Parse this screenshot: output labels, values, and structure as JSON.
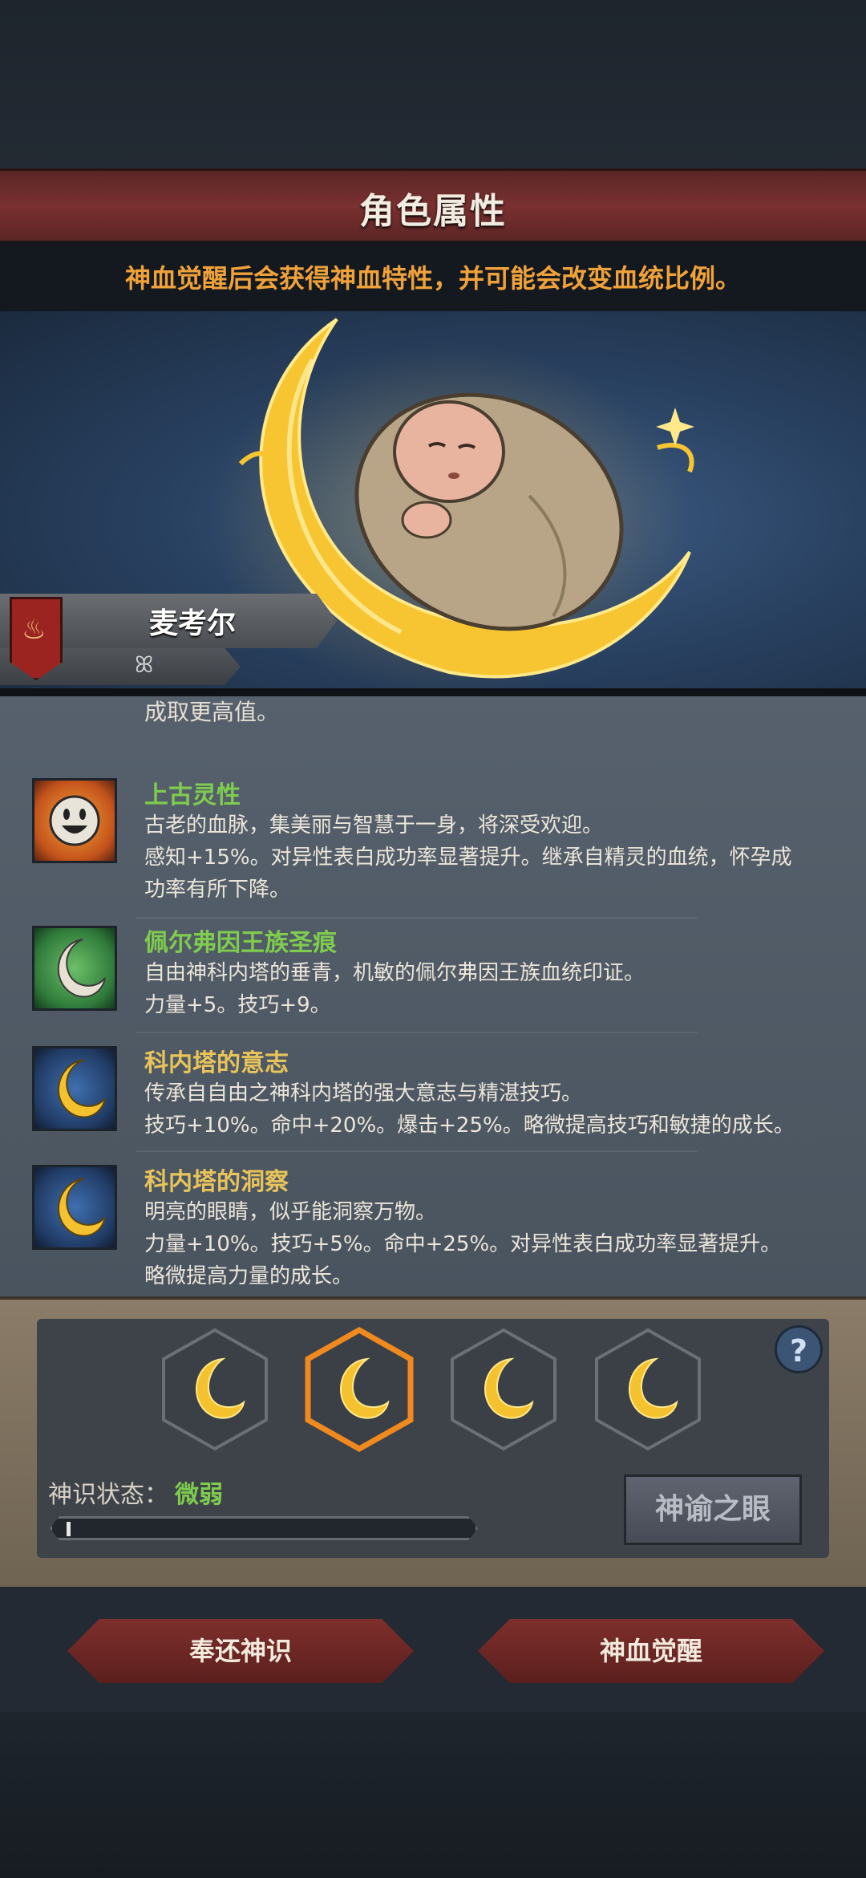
{
  "header": {
    "title": "角色属性",
    "hint": "神血觉醒后会获得神血特性，并可能会改变血统比例。"
  },
  "character": {
    "name": "麦考尔",
    "sub_icon": "ꕤ",
    "crest_icon": "flame-icon"
  },
  "traits": {
    "cut_line": "成取更高值。",
    "items": [
      {
        "name": "上古灵性",
        "icon": "smiley-sun-icon",
        "lines": [
          "古老的血脉，集美丽与智慧于一身，将深受欢迎。",
          "感知+15%。对异性表白成功率显著提升。继承自精灵的血统，怀孕成",
          "功率有所下降。"
        ]
      },
      {
        "name": "佩尔弗因王族圣痕",
        "icon": "white-crescent-icon",
        "lines": [
          "自由神科内塔的垂青，机敏的佩尔弗因王族血统印证。",
          "力量+5。技巧+9。"
        ]
      },
      {
        "name": "科内塔的意志",
        "icon": "gold-crescent-icon",
        "lines": [
          "传承自自由之神科内塔的强大意志与精湛技巧。",
          "技巧+10%。命中+20%。爆击+25%。略微提高技巧和敏捷的成长。"
        ]
      },
      {
        "name": "科内塔的洞察",
        "icon": "gold-crescent-icon",
        "lines": [
          "明亮的眼睛，似乎能洞察万物。",
          "力量+10%。技巧+5%。命中+25%。对异性表白成功率显著提升。",
          "略微提高力量的成长。"
        ]
      }
    ]
  },
  "panel": {
    "slots": [
      "crescent-slot-1",
      "crescent-slot-2",
      "crescent-slot-3",
      "crescent-slot-4"
    ],
    "selected_slot": 1,
    "help": "?",
    "status_label": "神识状态：",
    "status_value": "微弱",
    "progress": 0.01,
    "oracle_button": "神谕之眼"
  },
  "footer": {
    "return_button": "奉还神识",
    "awaken_button": "神血觉醒"
  },
  "colors": {
    "accent_green": "#7fcc4e",
    "hint_orange": "#f0a23a",
    "title_red": "#7a3030",
    "gold": "#e8c45a"
  }
}
